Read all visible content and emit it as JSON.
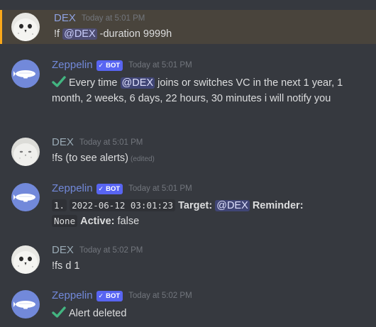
{
  "messages": [
    {
      "author": "DEX",
      "timestamp": "Today at 5:01 PM",
      "line_prefix": "!f ",
      "mention": "@DEX",
      "line_suffix": " -duration 9999h"
    },
    {
      "author": "Zeppelin",
      "bot_tag": "BOT",
      "timestamp": "Today at 5:01 PM",
      "text_before": "Every time ",
      "mention": "@DEX",
      "text_after": " joins or switches VC in the next 1 year, 1 month, 2 weeks, 6 days, 22 hours, 30 minutes i will notify you"
    },
    {
      "author": "DEX",
      "timestamp": "Today at 5:01 PM",
      "text": "!fs (to see alerts)",
      "edited": "(edited)"
    },
    {
      "author": "Zeppelin",
      "bot_tag": "BOT",
      "timestamp": "Today at 5:01 PM",
      "code_index": "1.",
      "code_datetime": "2022-06-12 03:01:23",
      "target_label": "Target:",
      "mention": "@DEX",
      "reminder_label": "Reminder:",
      "code_reminder": "None",
      "active_label": "Active:",
      "active_value": " false"
    },
    {
      "author": "DEX",
      "timestamp": "Today at 5:02 PM",
      "text": "!fs d 1"
    },
    {
      "author": "Zeppelin",
      "bot_tag": "BOT",
      "timestamp": "Today at 5:02 PM",
      "text": "Alert deleted"
    }
  ],
  "colors": {
    "background": "#36393f",
    "mention_highlight": "#49443c",
    "mention_border": "#faa81a",
    "bot_tag": "#5865f2",
    "zeppelin_name": "#7289da",
    "success_check": "#43b581"
  },
  "icons": {
    "dex_avatar": "snowy-owl-avatar",
    "zeppelin_avatar": "airship-avatar",
    "success": "white-heavy-check-mark-icon"
  }
}
